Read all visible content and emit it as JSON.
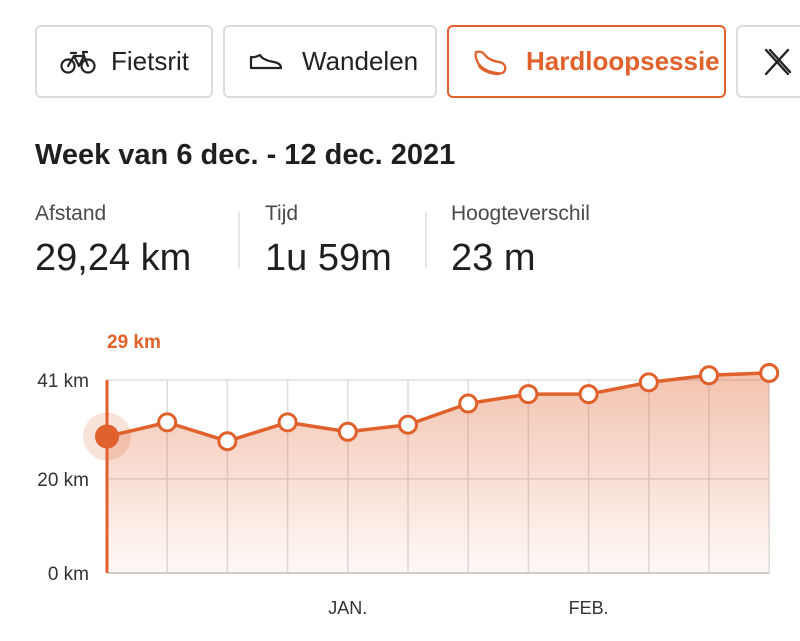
{
  "tabs": [
    {
      "label": "Fietsrit",
      "icon": "bike-icon",
      "active": false
    },
    {
      "label": "Wandelen",
      "icon": "shoe-icon",
      "active": false
    },
    {
      "label": "Hardloopsessie",
      "icon": "running-shoe-icon",
      "active": true
    },
    {
      "label": "",
      "icon": "close-icon",
      "active": false
    }
  ],
  "week_title": "Week van 6 dec. - 12 dec. 2021",
  "stats": [
    {
      "label": "Afstand",
      "value": "29,24 km"
    },
    {
      "label": "Tijd",
      "value": "1u 59m"
    },
    {
      "label": "Hoogteverschil",
      "value": "23 m"
    }
  ],
  "colors": {
    "accent": "#e0612c",
    "border": "#dcdcdc",
    "grid": "#dddddd",
    "text": "#1f1f1f"
  },
  "chart_data": {
    "type": "area",
    "selected_label": "29 km",
    "selected_index": 0,
    "y_ticks": [
      {
        "value": 0,
        "label": "0 km"
      },
      {
        "value": 20,
        "label": "20 km"
      },
      {
        "value": 41,
        "label": "41 km"
      }
    ],
    "ylim": [
      0,
      41
    ],
    "x_tick_labels": [
      {
        "index": 4,
        "label": "JAN."
      },
      {
        "index": 8,
        "label": "FEB."
      }
    ],
    "values": [
      29,
      32,
      28,
      32,
      30,
      31.5,
      36,
      38,
      38,
      40.5,
      42,
      42.5
    ],
    "grid": true
  }
}
